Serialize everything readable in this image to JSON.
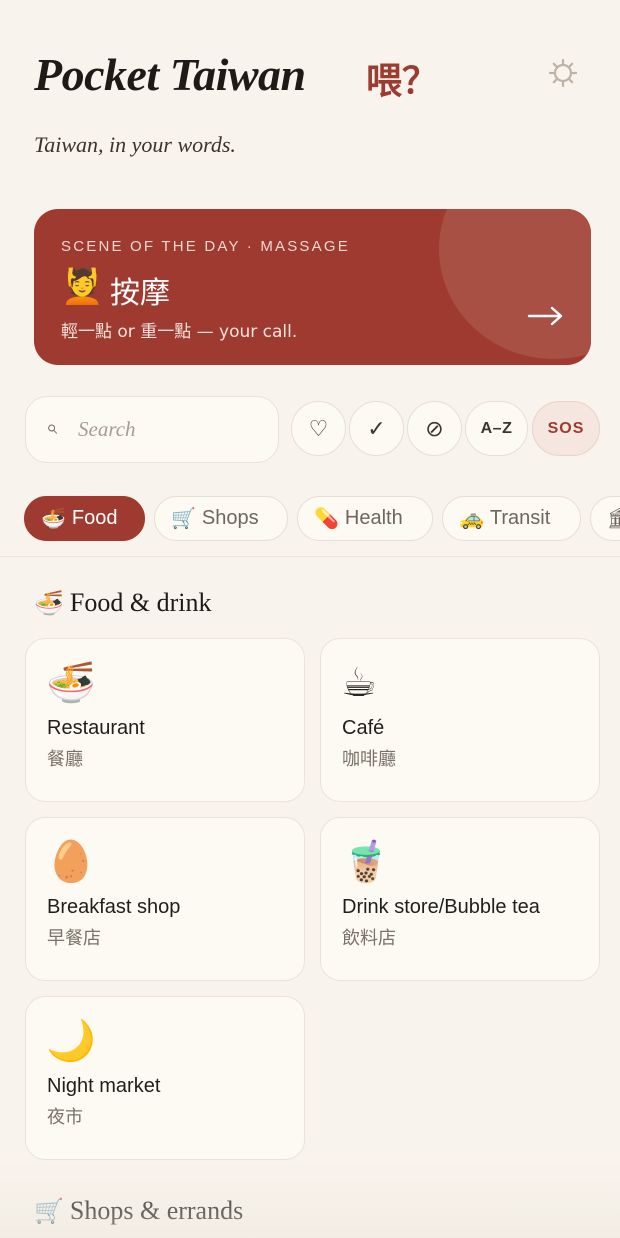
{
  "app": {
    "title": "Pocket Taiwan",
    "title_cn": "喂？",
    "tagline": "Taiwan, in your words.",
    "settings_icon": "gear-icon"
  },
  "scene": {
    "kicker": "SCENE OF THE DAY · MASSAGE",
    "emoji": "💆",
    "title": "按摩",
    "subtitle": "輕一點 or 重一點 — your call.",
    "arrow": "→",
    "background": "#9e3a2f"
  },
  "search": {
    "placeholder": "Search",
    "icon": "search-icon"
  },
  "filters": {
    "favorites": "♡",
    "learned": "✓",
    "hidden": "⊘",
    "az": "A–Z",
    "sos": "SOS"
  },
  "categories": [
    {
      "emoji": "🍜",
      "label": "Food",
      "active": true
    },
    {
      "emoji": "🛒",
      "label": "Shops",
      "active": false
    },
    {
      "emoji": "💊",
      "label": "Health",
      "active": false
    },
    {
      "emoji": "🚕",
      "label": "Transit",
      "active": false
    },
    {
      "emoji": "🏛",
      "label": "",
      "active": false
    }
  ],
  "sections": [
    {
      "emoji": "🍜",
      "title": "Food & drink",
      "items": [
        {
          "emoji": "🍜",
          "en": "Restaurant",
          "cn": "餐廳"
        },
        {
          "emoji": "☕",
          "en": "Café",
          "cn": "咖啡廳"
        },
        {
          "emoji": "🥚",
          "en": "Breakfast shop",
          "cn": "早餐店"
        },
        {
          "emoji": "🧋",
          "en": "Drink store/Bubble tea",
          "cn": "飲料店"
        },
        {
          "emoji": "🌙",
          "en": "Night market",
          "cn": "夜市"
        }
      ]
    },
    {
      "emoji": "🛒",
      "title": "Shops & errands",
      "items": []
    }
  ],
  "colors": {
    "accent": "#9e3a2f",
    "background": "#f8f3ec",
    "card": "#fdfaf3"
  }
}
